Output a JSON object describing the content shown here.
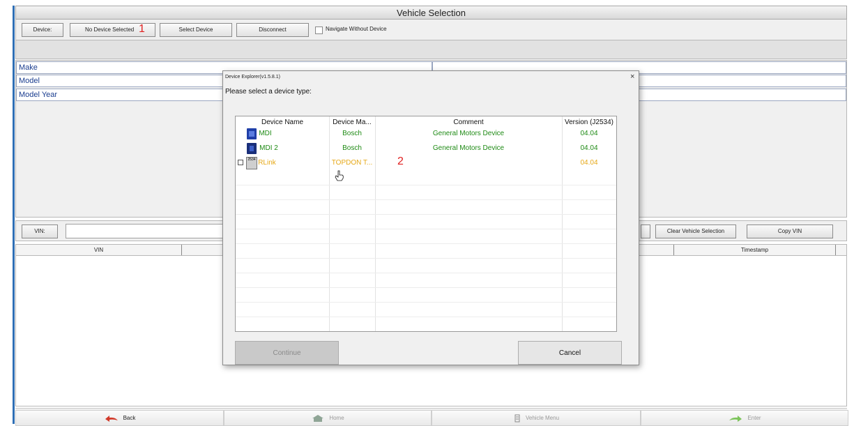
{
  "window": {
    "title": "Vehicle Selection"
  },
  "toolbar": {
    "device_label": "Device:",
    "device_value": "No Device Selected",
    "select_device": "Select Device",
    "disconnect": "Disconnect",
    "navigate_without_device": "Navigate Without Device",
    "annotation_1": "1"
  },
  "vehicle": {
    "rows": [
      "Make",
      "Model",
      "Model Year"
    ]
  },
  "vin_bar": {
    "vin_label": "VIN:",
    "clear_selection": "Clear Vehicle Selection",
    "copy_vin": "Copy VIN"
  },
  "history": {
    "columns": [
      "VIN",
      "Timestamp"
    ]
  },
  "dialog": {
    "title": "Device Explorer(v1.5.8.1)",
    "close": "×",
    "prompt": "Please select a device type:",
    "columns": [
      "Device Name",
      "Device Ma...",
      "Comment",
      "Version (J2534)"
    ],
    "rows": [
      {
        "name": "MDI",
        "manufacturer": "Bosch",
        "comment": "General Motors Device",
        "version": "04.04",
        "color": "#1e8a14"
      },
      {
        "name": "MDI 2",
        "manufacturer": "Bosch",
        "comment": "General Motors Device",
        "version": "04.04",
        "color": "#1e8a14"
      },
      {
        "name": "RLink",
        "manufacturer": "TOPDON T...",
        "comment": "",
        "version": "04.04",
        "color": "#e6a817"
      }
    ],
    "rlink_icon_text": "2534",
    "annotation_2": "2",
    "continue": "Continue",
    "cancel": "Cancel"
  },
  "bottom": {
    "back": "Back",
    "home": "Home",
    "vehicle_menu": "Vehicle Menu",
    "enter": "Enter"
  }
}
